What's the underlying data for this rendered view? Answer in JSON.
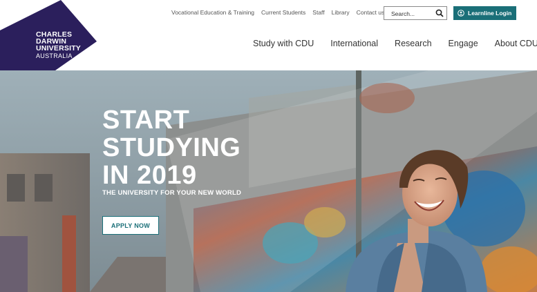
{
  "brand": {
    "name_lines": [
      "CHARLES",
      "DARWIN",
      "UNIVERSITY"
    ],
    "country": "AUSTRALIA",
    "color": "#2b1f5c"
  },
  "utility_nav": [
    {
      "label": "Vocational Education & Training"
    },
    {
      "label": "Current Students"
    },
    {
      "label": "Staff"
    },
    {
      "label": "Library"
    },
    {
      "label": "Contact us"
    }
  ],
  "search": {
    "placeholder": "Search..."
  },
  "learnline": {
    "label": "Learnline Login",
    "color": "#1a6f78"
  },
  "main_nav": [
    {
      "label": "Study with CDU"
    },
    {
      "label": "International"
    },
    {
      "label": "Research"
    },
    {
      "label": "Engage"
    },
    {
      "label": "About CDU"
    }
  ],
  "hero": {
    "title_lines": [
      "START",
      "STUDYING",
      "IN 2019"
    ],
    "subtitle": "THE UNIVERSITY FOR YOUR NEW WORLD",
    "cta_label": "APPLY NOW"
  }
}
